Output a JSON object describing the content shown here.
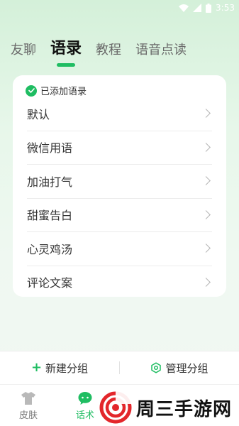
{
  "status_bar": {
    "time": "3:53"
  },
  "tabs": [
    {
      "label": "友聊",
      "active": false
    },
    {
      "label": "语录",
      "active": true
    },
    {
      "label": "教程",
      "active": false
    },
    {
      "label": "语音点读",
      "active": false
    }
  ],
  "card": {
    "header": "已添加语录",
    "items": [
      {
        "label": "默认"
      },
      {
        "label": "微信用语"
      },
      {
        "label": "加油打气"
      },
      {
        "label": "甜蜜告白"
      },
      {
        "label": "心灵鸡汤"
      },
      {
        "label": "评论文案"
      }
    ]
  },
  "actions": {
    "new_group": "新建分组",
    "manage_group": "管理分组"
  },
  "bottom_nav": [
    {
      "label": "皮肤",
      "icon": "tshirt-icon",
      "active": false
    },
    {
      "label": "话术",
      "icon": "chat-icon",
      "active": true
    }
  ],
  "watermark": {
    "text": "周三手游网"
  },
  "colors": {
    "accent": "#1fbd62",
    "background_top": "#d4f0d9"
  }
}
